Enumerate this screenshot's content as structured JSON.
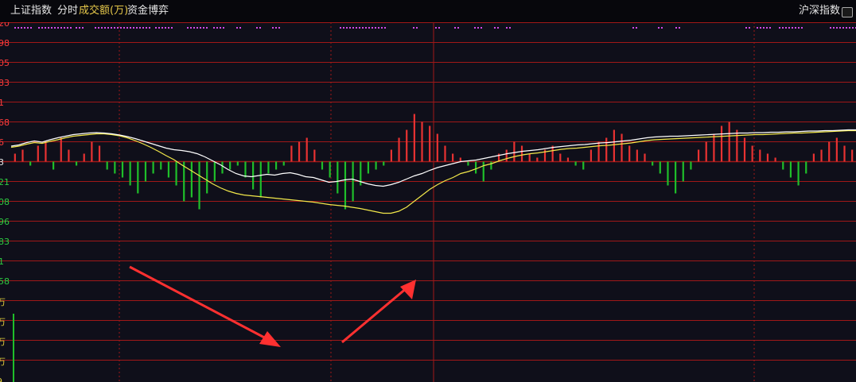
{
  "header": {
    "index_name": "上证指数",
    "tab_timeshare": "分时",
    "tab_volume": "成交额(万)",
    "tab_fund": "资金博弈",
    "market_label": "沪深指数"
  },
  "colors": {
    "grid": "#a01818",
    "up": "#e83232",
    "down": "#1fbf2a",
    "price_line": "#ffffff",
    "avg_line": "#f2e84a",
    "arrow": "#ff3030",
    "marker": "#d24be6",
    "header_text": "#e6e6e6",
    "active_tab": "#e6c84a",
    "axis_up": "#ff3c3c",
    "axis_down": "#2ecc40",
    "axis_flat": "#e6e6e6",
    "volume_axis": "#e6d23c"
  },
  "chart_data": {
    "type": "line",
    "y_axis_labels": [
      "20",
      "98",
      "05",
      "83",
      "1",
      "68",
      "6",
      "3",
      "21",
      "08",
      "96",
      "83",
      "1",
      "58"
    ],
    "volume_axis_labels": [
      "万",
      "万",
      "万",
      "万",
      "9"
    ],
    "series": [
      {
        "values": [
          0.39,
          0.42,
          0.48,
          0.52,
          0.49,
          0.55,
          0.6,
          0.64,
          0.68,
          0.7,
          0.72,
          0.73,
          0.72,
          0.7,
          0.67,
          0.63,
          0.58,
          0.52,
          0.46,
          0.4,
          0.34,
          0.3,
          0.28,
          0.25,
          0.2,
          0.12,
          0.02,
          -0.08,
          -0.2,
          -0.3,
          -0.36,
          -0.38,
          -0.35,
          -0.32,
          -0.34,
          -0.3,
          -0.28,
          -0.32,
          -0.38,
          -0.4,
          -0.46,
          -0.52,
          -0.5,
          -0.46,
          -0.44,
          -0.5,
          -0.56,
          -0.6,
          -0.62,
          -0.58,
          -0.52,
          -0.44,
          -0.36,
          -0.3,
          -0.22,
          -0.15,
          -0.1,
          -0.05,
          0.0,
          0.02,
          0.04,
          0.08,
          0.12,
          0.16,
          0.2,
          0.23,
          0.26,
          0.28,
          0.3,
          0.33,
          0.36,
          0.38,
          0.4,
          0.42,
          0.43,
          0.45,
          0.47,
          0.48,
          0.5,
          0.52,
          0.54,
          0.57,
          0.6,
          0.62,
          0.63,
          0.64,
          0.64,
          0.65,
          0.66,
          0.67,
          0.68,
          0.69,
          0.7,
          0.71,
          0.72,
          0.72,
          0.73,
          0.73,
          0.74,
          0.74,
          0.75,
          0.75,
          0.76,
          0.77,
          0.77,
          0.78,
          0.78,
          0.79,
          0.8,
          0.8
        ]
      },
      {
        "values": [
          0.36,
          0.39,
          0.44,
          0.48,
          0.46,
          0.51,
          0.55,
          0.6,
          0.64,
          0.66,
          0.68,
          0.7,
          0.7,
          0.68,
          0.65,
          0.6,
          0.53,
          0.45,
          0.36,
          0.26,
          0.15,
          0.05,
          -0.08,
          -0.2,
          -0.32,
          -0.44,
          -0.56,
          -0.66,
          -0.74,
          -0.8,
          -0.84,
          -0.86,
          -0.88,
          -0.9,
          -0.92,
          -0.94,
          -0.96,
          -0.98,
          -1.0,
          -1.02,
          -1.05,
          -1.08,
          -1.1,
          -1.12,
          -1.15,
          -1.18,
          -1.22,
          -1.26,
          -1.3,
          -1.3,
          -1.25,
          -1.15,
          -1.0,
          -0.85,
          -0.7,
          -0.58,
          -0.48,
          -0.4,
          -0.3,
          -0.25,
          -0.18,
          -0.1,
          -0.05,
          0.02,
          0.08,
          0.13,
          0.17,
          0.2,
          0.22,
          0.25,
          0.28,
          0.31,
          0.33,
          0.34,
          0.36,
          0.38,
          0.4,
          0.41,
          0.43,
          0.45,
          0.47,
          0.5,
          0.53,
          0.55,
          0.56,
          0.57,
          0.58,
          0.59,
          0.6,
          0.61,
          0.62,
          0.63,
          0.64,
          0.65,
          0.66,
          0.67,
          0.68,
          0.68,
          0.69,
          0.7,
          0.71,
          0.72,
          0.72,
          0.73,
          0.74,
          0.75,
          0.76,
          0.77,
          0.78,
          0.78
        ]
      }
    ],
    "money_flow": [
      2,
      3,
      -1,
      4,
      5,
      -2,
      6,
      3,
      -1,
      2,
      5,
      4,
      -2,
      -3,
      -4,
      -6,
      -8,
      -5,
      -3,
      -2,
      -4,
      -6,
      -10,
      -9,
      -12,
      -8,
      -5,
      -3,
      -2,
      -1,
      -4,
      -7,
      -9,
      -3,
      -2,
      -1,
      4,
      5,
      6,
      3,
      -2,
      -4,
      -8,
      -12,
      -10,
      -6,
      -3,
      -2,
      -1,
      3,
      6,
      8,
      12,
      10,
      9,
      7,
      4,
      2,
      1,
      -1,
      -3,
      -5,
      -2,
      2,
      3,
      5,
      4,
      2,
      1,
      3,
      4,
      2,
      1,
      -1,
      -2,
      3,
      5,
      6,
      8,
      7,
      4,
      3,
      2,
      -1,
      -3,
      -6,
      -8,
      -5,
      -2,
      3,
      5,
      7,
      9,
      10,
      8,
      6,
      4,
      3,
      2,
      1,
      -2,
      -4,
      -6,
      -3,
      2,
      3,
      5,
      6,
      4,
      3
    ]
  }
}
